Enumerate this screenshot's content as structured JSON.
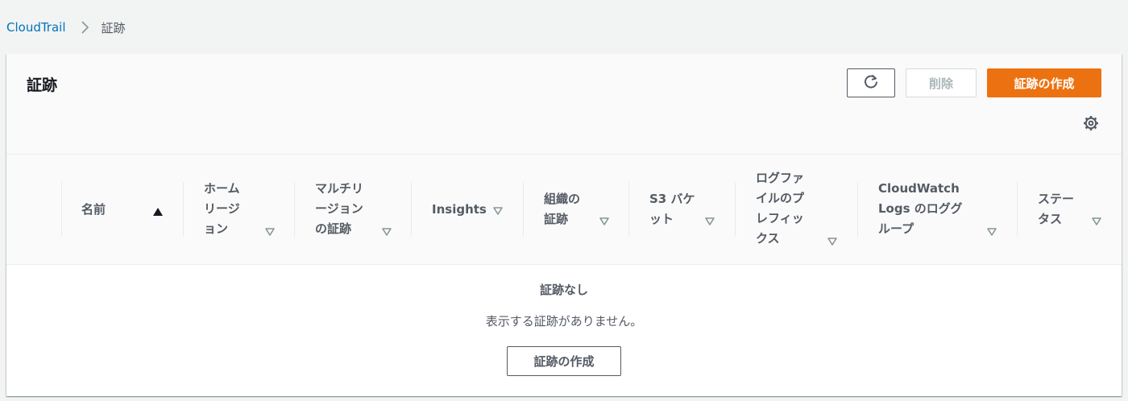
{
  "breadcrumb": {
    "root": "CloudTrail",
    "current": "証跡"
  },
  "panel": {
    "title": "証跡",
    "refresh_icon": "refresh-icon",
    "delete_label": "削除",
    "create_label": "証跡の作成",
    "settings_icon": "gear-icon"
  },
  "columns": [
    {
      "label": "名前",
      "sort": "ascending"
    },
    {
      "label": "ホーム\nリージ\nョン",
      "sort": "none"
    },
    {
      "label": "マルチリ\nージョン\nの証跡",
      "sort": "none"
    },
    {
      "label": "Insights",
      "sort": "none"
    },
    {
      "label": "組織の\n証跡",
      "sort": "none"
    },
    {
      "label": "S3 バケ\nット",
      "sort": "none"
    },
    {
      "label": "ログファ\nイルのプ\nレフィッ\nクス",
      "sort": "none"
    },
    {
      "label": "CloudWatch\nLogs のロググ\nループ",
      "sort": "none"
    },
    {
      "label": "ステー\nタス",
      "sort": "none"
    }
  ],
  "empty": {
    "title": "証跡なし",
    "description": "表示する証跡がありません。",
    "create_label": "証跡の作成"
  },
  "colors": {
    "link": "#0073bb",
    "primary": "#ec7211",
    "text_secondary": "#545b64",
    "background": "#f2f3f3"
  }
}
